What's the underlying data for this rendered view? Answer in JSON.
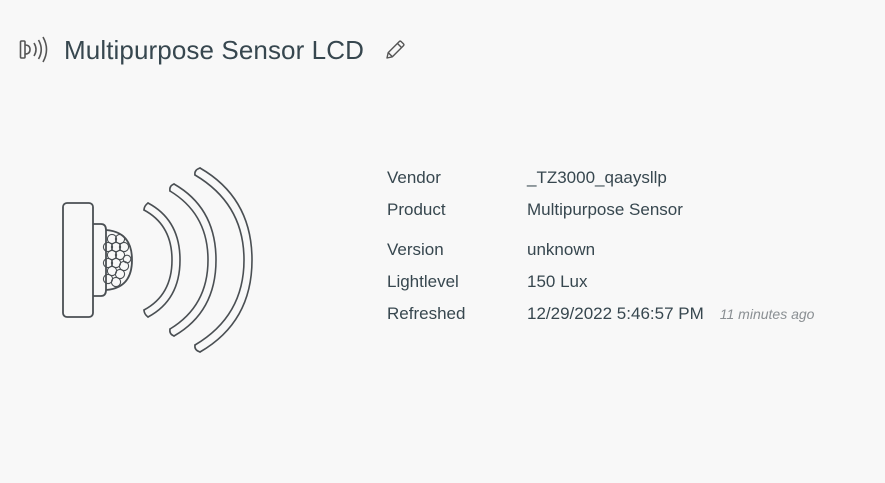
{
  "header": {
    "title": "Multipurpose Sensor LCD",
    "type_icon": "presence-sensor-icon",
    "edit_icon": "pencil-icon"
  },
  "illustration": {
    "icon": "presence-sensor-illustration"
  },
  "details": {
    "rows": [
      {
        "label": "Vendor",
        "value": "_TZ3000_qaaysllp"
      },
      {
        "label": "Product",
        "value": "Multipurpose Sensor"
      },
      {
        "label": "Version",
        "value": "unknown"
      },
      {
        "label": "Lightlevel",
        "value": "150 Lux"
      },
      {
        "label": "Refreshed",
        "value": "12/29/2022 5:46:57 PM",
        "note": "11 minutes ago"
      }
    ]
  },
  "colors": {
    "text": "#37474f",
    "muted": "#8a8f93",
    "background": "#f8f8f8",
    "stroke": "#4a4f53"
  }
}
